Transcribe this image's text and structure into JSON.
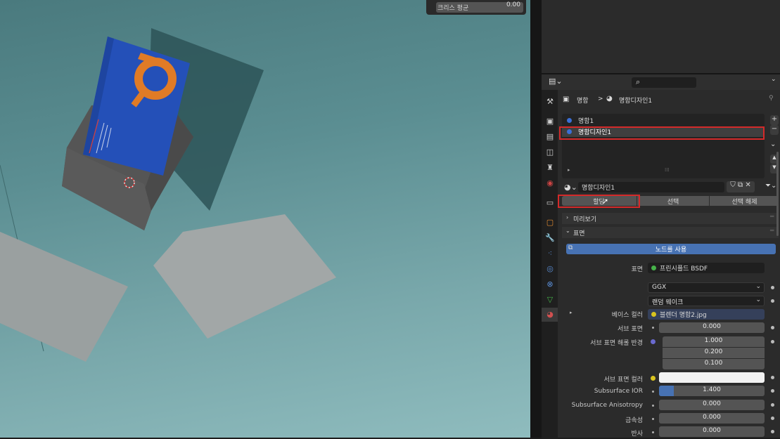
{
  "viewport": {
    "header_label": "크리스 평균",
    "header_value": "0.00"
  },
  "properties": {
    "breadcrumb": {
      "object": "명함",
      "separator": ">",
      "material": "명함디자인1"
    },
    "slots": [
      {
        "name": "명함1",
        "color": "#3b6fd6"
      },
      {
        "name": "명함디자인1",
        "color": "#3b6fd6"
      }
    ],
    "material_name": "명함디자인1",
    "assign_buttons": [
      "할당",
      "선택",
      "선택 해제"
    ],
    "panels": {
      "preview": "미리보기",
      "surface": "표면"
    },
    "use_nodes_label": "노드를 사용",
    "surface_label": "표면",
    "surface_shader": "프린시플드 BSDF",
    "distribution": "GGX",
    "subsurface_method": "랜덤 웨이크",
    "rows": {
      "base_color": {
        "label": "베이스 컬러",
        "value": "블렌더 명함2.jpg"
      },
      "subsurface": {
        "label": "서브 표면",
        "value": "0.000"
      },
      "subsurface_radius": {
        "label": "서브 표면 해롤 반경",
        "values": [
          "1.000",
          "0.200",
          "0.100"
        ]
      },
      "subsurface_color": {
        "label": "서브 표면 컬러"
      },
      "subsurface_ior": {
        "label": "Subsurface IOR",
        "value": "1.400",
        "fill": 0.14
      },
      "subsurface_aniso": {
        "label": "Subsurface Anisotropy",
        "value": "0.000"
      },
      "metallic": {
        "label": "금속성",
        "value": "0.000"
      },
      "specular": {
        "label": "반사",
        "value": "0.000"
      }
    },
    "colors": {
      "accent": "#4772b3",
      "highlight_red": "#d42a2a",
      "green": "#46b34a",
      "yellow": "#d9c41f",
      "purple": "#6a6ad0"
    }
  }
}
